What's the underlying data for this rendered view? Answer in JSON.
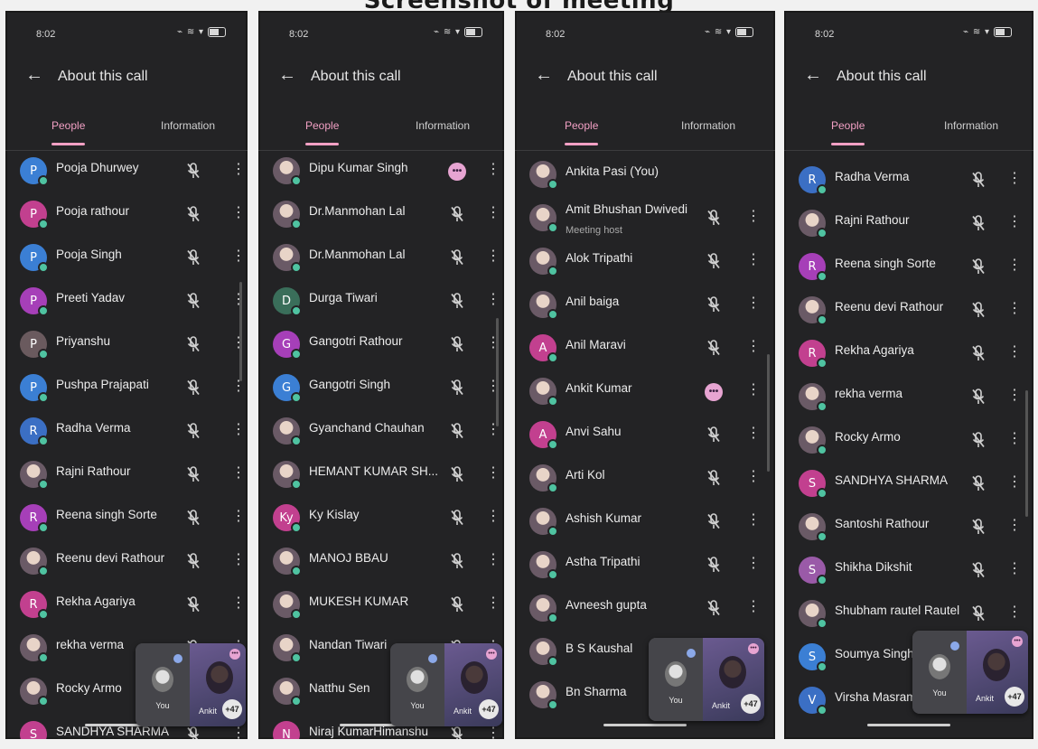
{
  "heading": "Screenshot of meeting",
  "colors": {
    "screen_bg": "#232325",
    "accent": "#f2a0c4",
    "online_dot": "#4fc3a1"
  },
  "screens": [
    {
      "status": {
        "time": "8:02",
        "icons": "⌁ ≋ ▾"
      },
      "app_title": "About this call",
      "tabs": {
        "people": "People",
        "information": "Information"
      },
      "participants": [
        {
          "initial": "P",
          "name": "Pooja Dhurwey",
          "color": "#3b7fd4",
          "state": "muted"
        },
        {
          "initial": "P",
          "name": "Pooja rathour",
          "color": "#c2408f",
          "state": "muted"
        },
        {
          "initial": "P",
          "name": "Pooja Singh",
          "color": "#3b7fd4",
          "state": "muted"
        },
        {
          "initial": "P",
          "name": "Preeti Yadav",
          "color": "#a63fb8",
          "state": "muted"
        },
        {
          "initial": "P",
          "name": "Priyanshu",
          "color": "#6a5a5e",
          "state": "muted"
        },
        {
          "initial": "P",
          "name": "Pushpa Prajapati",
          "color": "#3b7fd4",
          "state": "muted"
        },
        {
          "initial": "R",
          "name": "Radha Verma",
          "color": "#3b6fc4",
          "state": "muted"
        },
        {
          "initial": "",
          "name": "Rajni Rathour",
          "color": "",
          "state": "muted"
        },
        {
          "initial": "R",
          "name": "Reena singh Sorte",
          "color": "#a63fb8",
          "state": "muted"
        },
        {
          "initial": "",
          "name": "Reenu devi Rathour",
          "color": "",
          "state": "muted"
        },
        {
          "initial": "R",
          "name": "Rekha Agariya",
          "color": "#c2408f",
          "state": "muted"
        },
        {
          "initial": "",
          "name": "rekha verma",
          "color": "",
          "state": "muted"
        },
        {
          "initial": "",
          "name": "Rocky Armo",
          "color": "",
          "state": "muted"
        },
        {
          "initial": "S",
          "name": "SANDHYA SHARMA",
          "color": "#c2408f",
          "state": "muted"
        }
      ],
      "pip": {
        "self_label": "You",
        "other_label": "Ankit",
        "count": "+47"
      }
    },
    {
      "status": {
        "time": "8:02",
        "icons": "⌁ ≋ ▾"
      },
      "app_title": "About this call",
      "tabs": {
        "people": "People",
        "information": "Information"
      },
      "participants": [
        {
          "initial": "",
          "name": "Dipu Kumar Singh",
          "color": "",
          "state": "speaking"
        },
        {
          "initial": "",
          "name": "Dr.Manmohan Lal",
          "color": "",
          "state": "muted"
        },
        {
          "initial": "",
          "name": "Dr.Manmohan Lal",
          "color": "",
          "state": "muted"
        },
        {
          "initial": "D",
          "name": "Durga Tiwari",
          "color": "#3a6e5a",
          "state": "muted"
        },
        {
          "initial": "G",
          "name": "Gangotri Rathour",
          "color": "#a63fb8",
          "state": "muted"
        },
        {
          "initial": "G",
          "name": "Gangotri Singh",
          "color": "#3b7fd4",
          "state": "muted"
        },
        {
          "initial": "",
          "name": "Gyanchand Chauhan",
          "color": "",
          "state": "muted"
        },
        {
          "initial": "",
          "name": "HEMANT KUMAR SH...",
          "color": "",
          "state": "muted"
        },
        {
          "initial": "Ky",
          "name": "Ky Kislay",
          "color": "#c2408f",
          "state": "muted"
        },
        {
          "initial": "",
          "name": "MANOJ BBAU",
          "color": "",
          "state": "muted"
        },
        {
          "initial": "",
          "name": "MUKESH KUMAR",
          "color": "",
          "state": "muted"
        },
        {
          "initial": "",
          "name": "Nandan Tiwari",
          "color": "",
          "state": "muted"
        },
        {
          "initial": "",
          "name": "Natthu Sen",
          "color": "",
          "state": "muted"
        },
        {
          "initial": "N",
          "name": "Niraj KumarHimanshu",
          "color": "#c2408f",
          "state": "muted"
        }
      ],
      "pip": {
        "self_label": "You",
        "other_label": "Ankit",
        "count": "+47"
      }
    },
    {
      "status": {
        "time": "8:02",
        "icons": "⌁ ≋ ▾"
      },
      "app_title": "About this call",
      "tabs": {
        "people": "People",
        "information": "Information"
      },
      "participants": [
        {
          "initial": "",
          "name": "Ankita Pasi (You)",
          "color": "",
          "state": "none"
        },
        {
          "initial": "",
          "name": "Amit Bhushan Dwivedi",
          "sub": "Meeting host",
          "color": "",
          "state": "muted"
        },
        {
          "initial": "",
          "name": "Alok Tripathi",
          "color": "",
          "state": "muted"
        },
        {
          "initial": "",
          "name": "Anil baiga",
          "color": "",
          "state": "muted"
        },
        {
          "initial": "A",
          "name": "Anil Maravi",
          "color": "#c2408f",
          "state": "muted"
        },
        {
          "initial": "",
          "name": "Ankit Kumar",
          "color": "",
          "state": "speaking"
        },
        {
          "initial": "A",
          "name": "Anvi Sahu",
          "color": "#c2408f",
          "state": "muted"
        },
        {
          "initial": "",
          "name": "Arti Kol",
          "color": "",
          "state": "muted"
        },
        {
          "initial": "",
          "name": "Ashish Kumar",
          "color": "",
          "state": "muted"
        },
        {
          "initial": "",
          "name": "Astha Tripathi",
          "color": "",
          "state": "muted"
        },
        {
          "initial": "",
          "name": "Avneesh gupta",
          "color": "",
          "state": "muted"
        },
        {
          "initial": "",
          "name": "B S Kaushal",
          "color": "",
          "state": "muted"
        },
        {
          "initial": "",
          "name": "Bn Sharma",
          "color": "",
          "state": "muted"
        }
      ],
      "pip": {
        "self_label": "You",
        "other_label": "Ankit",
        "count": "+47"
      }
    },
    {
      "status": {
        "time": "8:02",
        "icons": "⌁ ≋ ▾"
      },
      "app_title": "About this call",
      "tabs": {
        "people": "People",
        "information": "Information"
      },
      "participants": [
        {
          "initial": "R",
          "name": "Radha Verma",
          "color": "#3b6fc4",
          "state": "muted"
        },
        {
          "initial": "",
          "name": "Rajni Rathour",
          "color": "",
          "state": "muted"
        },
        {
          "initial": "R",
          "name": "Reena singh Sorte",
          "color": "#a63fb8",
          "state": "muted"
        },
        {
          "initial": "",
          "name": "Reenu devi Rathour",
          "color": "",
          "state": "muted"
        },
        {
          "initial": "R",
          "name": "Rekha Agariya",
          "color": "#c2408f",
          "state": "muted"
        },
        {
          "initial": "",
          "name": "rekha verma",
          "color": "",
          "state": "muted"
        },
        {
          "initial": "",
          "name": "Rocky Armo",
          "color": "",
          "state": "muted"
        },
        {
          "initial": "S",
          "name": "SANDHYA SHARMA",
          "color": "#c2408f",
          "state": "muted"
        },
        {
          "initial": "",
          "name": "Santoshi Rathour",
          "color": "",
          "state": "muted"
        },
        {
          "initial": "S",
          "name": "Shikha Dikshit",
          "color": "#9a5aa8",
          "state": "muted"
        },
        {
          "initial": "",
          "name": "Shubham rautel Rautel",
          "color": "",
          "state": "muted"
        },
        {
          "initial": "S",
          "name": "Soumya Singh",
          "color": "#3b7fd4",
          "state": "muted"
        },
        {
          "initial": "V",
          "name": "Virsha Masram",
          "color": "#3b6fc4",
          "state": "muted"
        }
      ],
      "pip": {
        "self_label": "You",
        "other_label": "Ankit",
        "count": "+47"
      }
    }
  ]
}
